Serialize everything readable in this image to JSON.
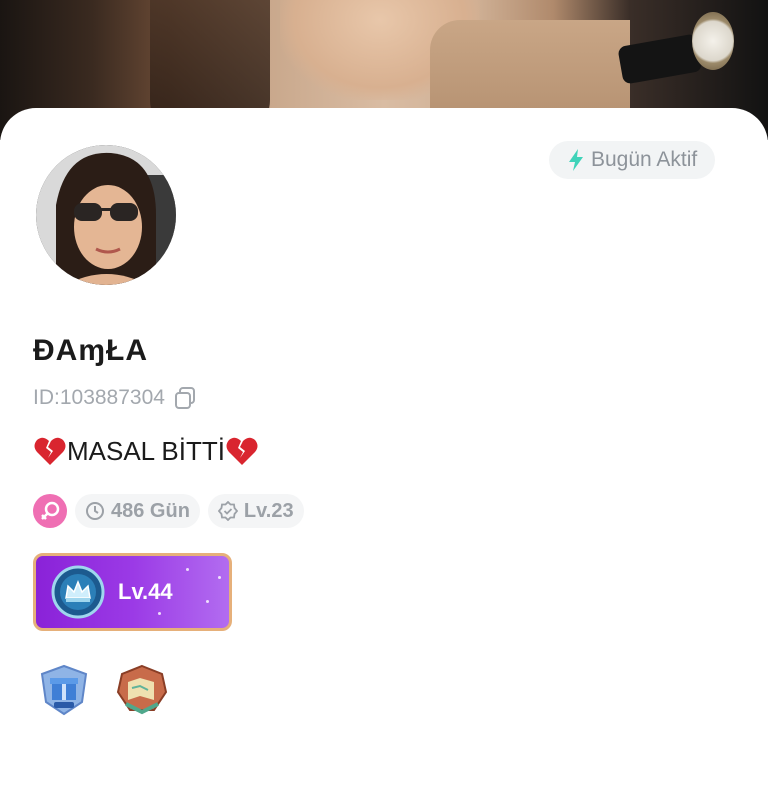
{
  "header": {
    "active_status": "Bugün Aktif",
    "icons": [
      "lightning-icon"
    ]
  },
  "profile": {
    "name": "ĐAɱŁA",
    "id_text": "ID:103887304",
    "bio_text": "MASAL BİTTİ",
    "bio_emoji": "broken-heart",
    "gender": "female",
    "days_text": "486 Gün",
    "user_level": "Lv.23",
    "wealth_level": "Lv.44"
  },
  "colors": {
    "accent_teal": "#3fd3b9",
    "gender_pink": "#ef6fb3",
    "level_purple": "#9b3ae6",
    "text_gray": "#a3a8ae"
  }
}
